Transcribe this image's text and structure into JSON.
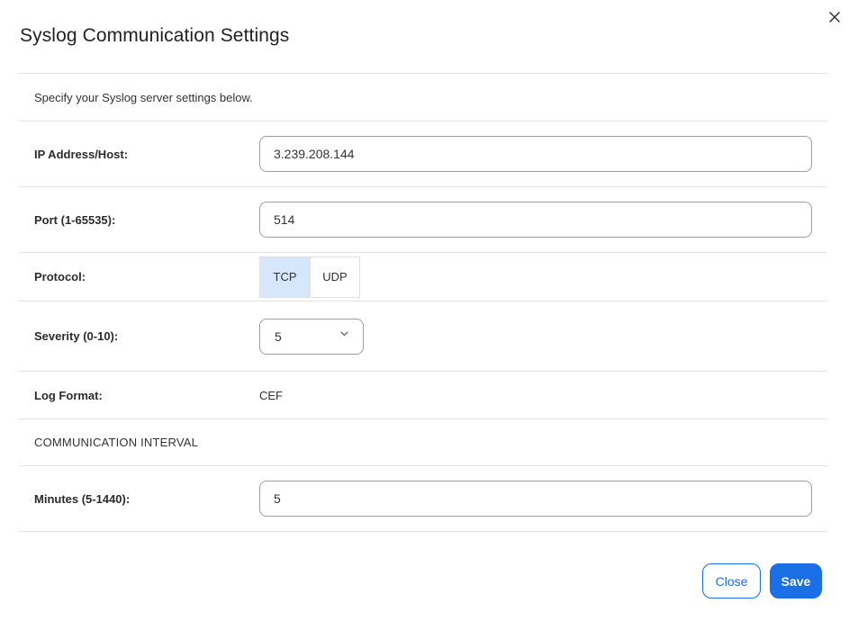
{
  "dialog": {
    "title": "Syslog Communication Settings",
    "intro": "Specify your Syslog server settings below."
  },
  "fields": {
    "ip": {
      "label": "IP Address/Host:",
      "value": "3.239.208.144"
    },
    "port": {
      "label": "Port (1-65535):",
      "value": "514"
    },
    "protocol": {
      "label": "Protocol:",
      "options": [
        "TCP",
        "UDP"
      ],
      "selected": "TCP"
    },
    "severity": {
      "label": "Severity (0-10):",
      "value": "5"
    },
    "log_format": {
      "label": "Log Format:",
      "value": "CEF"
    },
    "section_heading": "COMMUNICATION INTERVAL",
    "minutes": {
      "label": "Minutes (5-1440):",
      "value": "5"
    }
  },
  "buttons": {
    "close_label": "Close",
    "save_label": "Save"
  },
  "colors": {
    "accent": "#1a6ee6",
    "toggle_active": "#d6e6fb",
    "divider": "#e3e3e3"
  },
  "icons": {
    "dismiss": "close-icon",
    "dropdown": "chevron-down-icon"
  }
}
